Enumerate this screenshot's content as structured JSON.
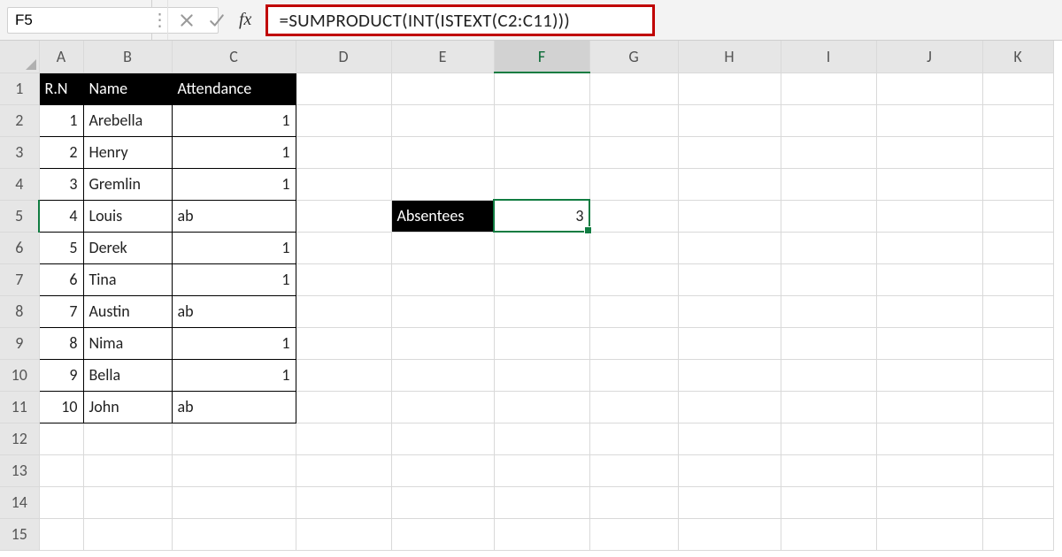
{
  "namebox": {
    "value": "F5"
  },
  "formula_bar": {
    "formula": "=SUMPRODUCT(INT(ISTEXT(C2:C11)))"
  },
  "columns": [
    "A",
    "B",
    "C",
    "D",
    "E",
    "F",
    "G",
    "H",
    "I",
    "J",
    "K"
  ],
  "row_headers": [
    "1",
    "2",
    "3",
    "4",
    "5",
    "6",
    "7",
    "8",
    "9",
    "10",
    "11",
    "12",
    "13",
    "14",
    "15"
  ],
  "table": {
    "headers": {
      "rn": "R.N",
      "name": "Name",
      "attendance": "Attendance"
    },
    "rows": [
      {
        "rn": "1",
        "name": "Arebella",
        "att": "1"
      },
      {
        "rn": "2",
        "name": "Henry",
        "att": "1"
      },
      {
        "rn": "3",
        "name": "Gremlin",
        "att": "1"
      },
      {
        "rn": "4",
        "name": "Louis",
        "att": "ab"
      },
      {
        "rn": "5",
        "name": "Derek",
        "att": "1"
      },
      {
        "rn": "6",
        "name": "Tina",
        "att": "1"
      },
      {
        "rn": "7",
        "name": "Austin",
        "att": "ab"
      },
      {
        "rn": "8",
        "name": "Nima",
        "att": "1"
      },
      {
        "rn": "9",
        "name": "Bella",
        "att": "1"
      },
      {
        "rn": "10",
        "name": "John",
        "att": "ab"
      }
    ]
  },
  "absentees": {
    "label": "Absentees",
    "value": "3"
  },
  "active_cell": "F5",
  "colors": {
    "accent": "#107c41",
    "highlight_border": "#c00000"
  }
}
